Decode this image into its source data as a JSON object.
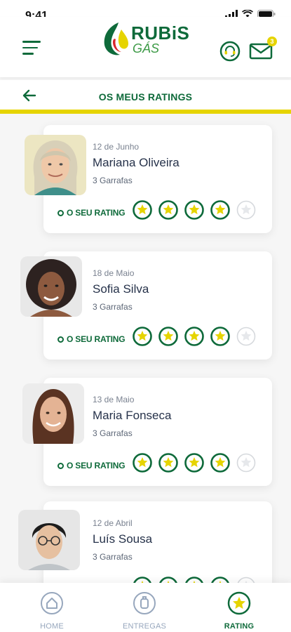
{
  "status_bar": {
    "time": "9:41"
  },
  "brand": {
    "name": "RUBiS",
    "subname": "GÁS"
  },
  "header": {
    "title": "OS MEUS RATINGS",
    "mail_badge": "3"
  },
  "rating_label": "O SEU RATING",
  "ratings": [
    {
      "date": "12 de Junho",
      "name": "Mariana Oliveira",
      "quantity": "3 Garrafas",
      "stars": 4,
      "max_stars": 5
    },
    {
      "date": "18 de Maio",
      "name": "Sofia Silva",
      "quantity": "3 Garrafas",
      "stars": 4,
      "max_stars": 5
    },
    {
      "date": "13 de Maio",
      "name": "Maria Fonseca",
      "quantity": "3 Garrafas",
      "stars": 4,
      "max_stars": 5
    },
    {
      "date": "12 de Abril",
      "name": "Luís Sousa",
      "quantity": "3 Garrafas",
      "stars": 4,
      "max_stars": 5
    }
  ],
  "bottom_nav": [
    {
      "label": "HOME",
      "icon": "home-icon",
      "active": false
    },
    {
      "label": "ENTREGAS",
      "icon": "delivery-icon",
      "active": false
    },
    {
      "label": "RATING",
      "icon": "star-icon",
      "active": true
    }
  ],
  "colors": {
    "brand_green": "#0e6a3a",
    "brand_yellow": "#e6d400",
    "star_fill": "#e6d400",
    "inactive": "#97a7bd"
  }
}
